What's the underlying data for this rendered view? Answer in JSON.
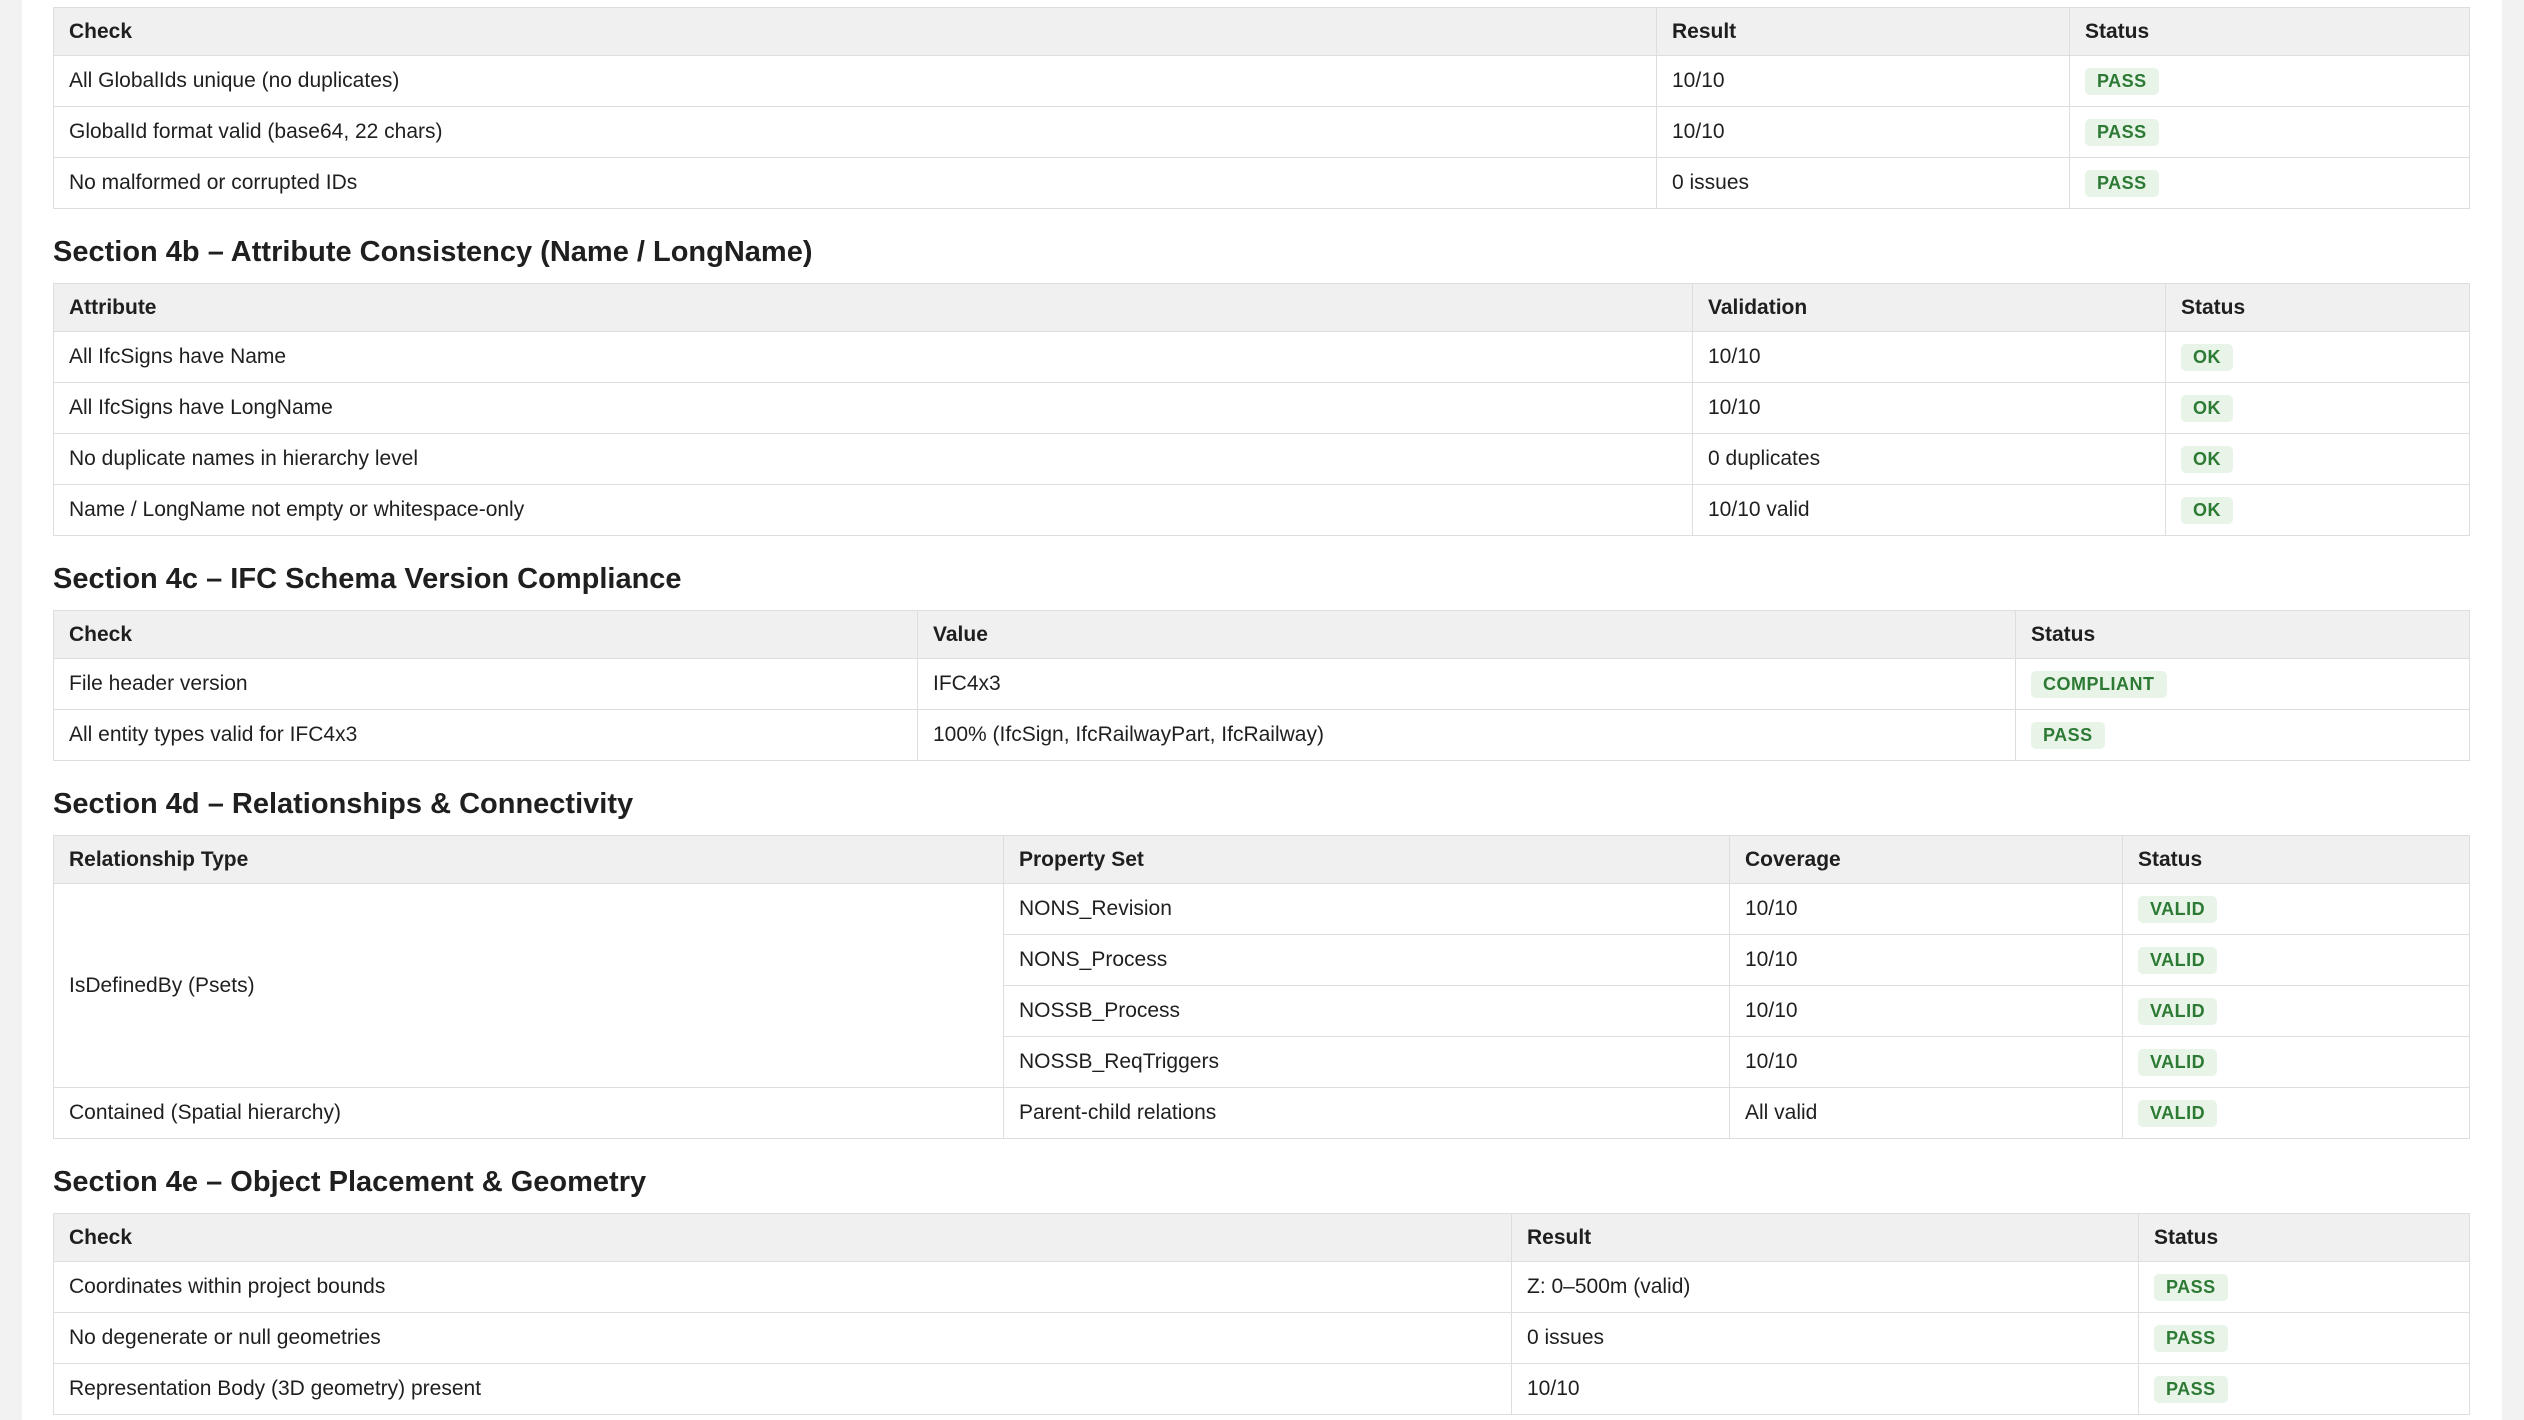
{
  "sections": {
    "top": {
      "headers": [
        "Check",
        "Result",
        "Status"
      ],
      "rows": [
        {
          "check": "All GlobalIds unique (no duplicates)",
          "result": "10/10",
          "status": "PASS"
        },
        {
          "check": "GlobalId format valid (base64, 22 chars)",
          "result": "10/10",
          "status": "PASS"
        },
        {
          "check": "No malformed or corrupted IDs",
          "result": "0 issues",
          "status": "PASS"
        }
      ]
    },
    "s4b": {
      "title": "Section 4b – Attribute Consistency (Name / LongName)",
      "headers": [
        "Attribute",
        "Validation",
        "Status"
      ],
      "rows": [
        {
          "attribute": "All IfcSigns have Name",
          "validation": "10/10",
          "status": "OK"
        },
        {
          "attribute": "All IfcSigns have LongName",
          "validation": "10/10",
          "status": "OK"
        },
        {
          "attribute": "No duplicate names in hierarchy level",
          "validation": "0 duplicates",
          "status": "OK"
        },
        {
          "attribute": "Name / LongName not empty or whitespace-only",
          "validation": "10/10 valid",
          "status": "OK"
        }
      ]
    },
    "s4c": {
      "title": "Section 4c – IFC Schema Version Compliance",
      "headers": [
        "Check",
        "Value",
        "Status"
      ],
      "rows": [
        {
          "check": "File header version",
          "value": "IFC4x3",
          "status": "COMPLIANT"
        },
        {
          "check": "All entity types valid for IFC4x3",
          "value": "100% (IfcSign, IfcRailwayPart, IfcRailway)",
          "status": "PASS"
        }
      ]
    },
    "s4d": {
      "title": "Section 4d – Relationships & Connectivity",
      "headers": [
        "Relationship Type",
        "Property Set",
        "Coverage",
        "Status"
      ],
      "group1": {
        "type": "IsDefinedBy (Psets)",
        "rows": [
          {
            "pset": "NONS_Revision",
            "coverage": "10/10",
            "status": "VALID"
          },
          {
            "pset": "NONS_Process",
            "coverage": "10/10",
            "status": "VALID"
          },
          {
            "pset": "NOSSB_Process",
            "coverage": "10/10",
            "status": "VALID"
          },
          {
            "pset": "NOSSB_ReqTriggers",
            "coverage": "10/10",
            "status": "VALID"
          }
        ]
      },
      "row2": {
        "type": "Contained (Spatial hierarchy)",
        "pset": "Parent-child relations",
        "coverage": "All valid",
        "status": "VALID"
      }
    },
    "s4e": {
      "title": "Section 4e – Object Placement & Geometry",
      "headers": [
        "Check",
        "Result",
        "Status"
      ],
      "rows": [
        {
          "check": "Coordinates within project bounds",
          "result": "Z: 0–500m (valid)",
          "status": "PASS"
        },
        {
          "check": "No degenerate or null geometries",
          "result": "0 issues",
          "status": "PASS"
        },
        {
          "check": "Representation Body (3D geometry) present",
          "result": "10/10",
          "status": "PASS"
        }
      ]
    }
  },
  "colors": {
    "badge_bg": "#e7f4e7",
    "badge_text": "#2d7a35",
    "header_bg": "#f0f0f0",
    "border": "#dedede"
  }
}
